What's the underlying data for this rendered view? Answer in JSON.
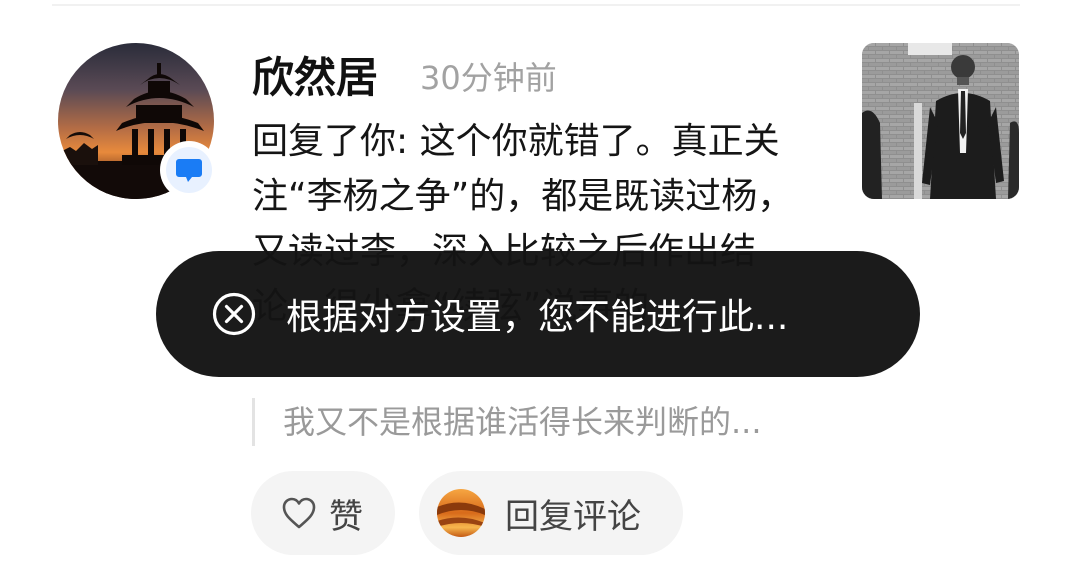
{
  "comment": {
    "username": "欣然居",
    "timestamp": "30分钟前",
    "text": "回复了你: 这个你就错了。真正关注“李杨之争”的，都是既读过杨，又读过李，深入比较之后作出结论。很少拿“续弦”说事的",
    "quote": "我又不是根据谁活得长来判断的..."
  },
  "actions": {
    "like_label": "赞",
    "reply_label": "回复评论"
  },
  "toast": {
    "message": "根据对方设置，您不能进行此..."
  },
  "icons": {
    "avatar_badge": "chat-bubble-icon",
    "like": "heart-outline-icon",
    "toast": "close-circle-icon"
  },
  "colors": {
    "badge_blue": "#1a7cf5",
    "toast_bg": "#141414",
    "timestamp_gray": "#a2a2a2"
  }
}
